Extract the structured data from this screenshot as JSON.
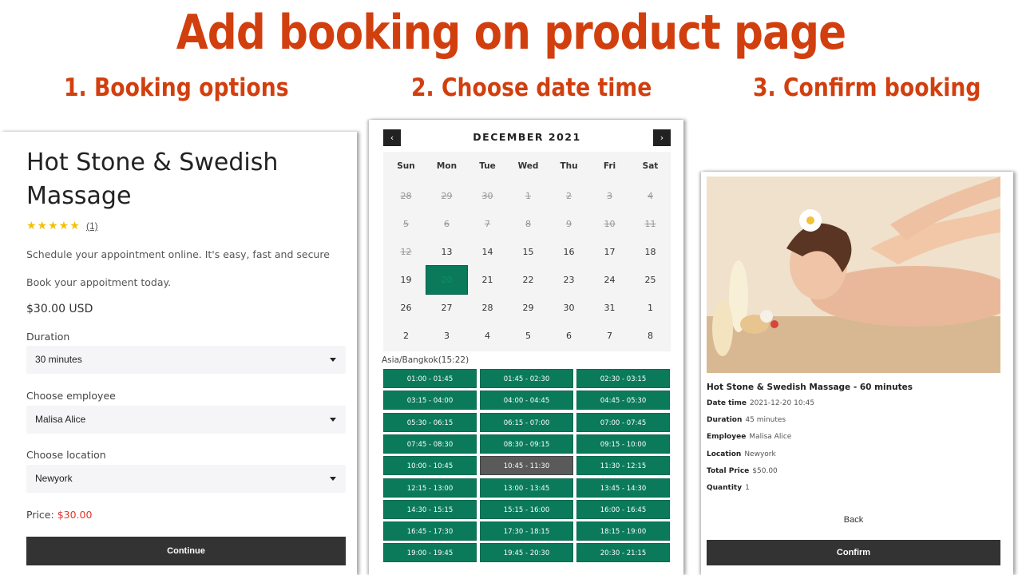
{
  "header": {
    "title": "Add booking on product page",
    "step1": "1. Booking options",
    "step2": "2. Choose date time",
    "step3": "3. Confirm booking"
  },
  "product": {
    "title": "Hot Stone & Swedish Massage",
    "rating_stars": "★★★★★",
    "rating_value": 5,
    "review_count": "(1)",
    "description1": "Schedule your appointment online. It's easy, fast and secure",
    "description2": "Book your appoitment today.",
    "price": "$30.00 USD",
    "duration_label": "Duration",
    "duration_value": "30 minutes",
    "employee_label": "Choose employee",
    "employee_value": "Malisa Alice",
    "location_label": "Choose location",
    "location_value": "Newyork",
    "price_label": "Price:",
    "price_value": "$30.00",
    "continue_label": "Continue"
  },
  "calendar": {
    "month": "DECEMBER 2021",
    "prev_icon": "‹",
    "next_icon": "›",
    "weekdays": [
      "Sun",
      "Mon",
      "Tue",
      "Wed",
      "Thu",
      "Fri",
      "Sat"
    ],
    "weeks": [
      [
        "28",
        "29",
        "30",
        "1",
        "2",
        "3",
        "4"
      ],
      [
        "5",
        "6",
        "7",
        "8",
        "9",
        "10",
        "11"
      ],
      [
        "12",
        "13",
        "14",
        "15",
        "16",
        "17",
        "18"
      ],
      [
        "19",
        "20",
        "21",
        "22",
        "23",
        "24",
        "25"
      ],
      [
        "26",
        "27",
        "28",
        "29",
        "30",
        "31",
        "1"
      ],
      [
        "2",
        "3",
        "4",
        "5",
        "6",
        "7",
        "8"
      ]
    ],
    "past_count": 15,
    "selected": "20",
    "timezone": "Asia/Bangkok(15:22)",
    "slots": [
      "01:00 - 01:45",
      "01:45 - 02:30",
      "02:30 - 03:15",
      "03:15 - 04:00",
      "04:00 - 04:45",
      "04:45 - 05:30",
      "05:30 - 06:15",
      "06:15 - 07:00",
      "07:00 - 07:45",
      "07:45 - 08:30",
      "08:30 - 09:15",
      "09:15 - 10:00",
      "10:00 - 10:45",
      "10:45 - 11:30",
      "11:30 - 12:15",
      "12:15 - 13:00",
      "13:00 - 13:45",
      "13:45 - 14:30",
      "14:30 - 15:15",
      "15:15 - 16:00",
      "16:00 - 16:45",
      "16:45 - 17:30",
      "17:30 - 18:15",
      "18:15 - 19:00",
      "19:00 - 19:45",
      "19:45 - 20:30",
      "20:30 - 21:15"
    ],
    "selected_slot": "10:45 - 11:30",
    "colors": {
      "accent": "#0a7a5b",
      "selected_slot": "#5a5a5a"
    }
  },
  "confirm": {
    "image_icon": "massage-photo",
    "title": "Hot Stone & Swedish Massage - 60 minutes",
    "rows": [
      {
        "label": "Date time",
        "value": "2021-12-20 10:45"
      },
      {
        "label": "Duration",
        "value": "45 minutes"
      },
      {
        "label": "Employee",
        "value": "Malisa Alice"
      },
      {
        "label": "Location",
        "value": "Newyork"
      },
      {
        "label": "Total Price",
        "value": "$50.00"
      },
      {
        "label": "Quantity",
        "value": "1"
      }
    ],
    "back_label": "Back",
    "confirm_label": "Confirm"
  },
  "colors": {
    "headline": "#d23f0f",
    "price_red": "#e0352b",
    "button_dark": "#333333"
  }
}
